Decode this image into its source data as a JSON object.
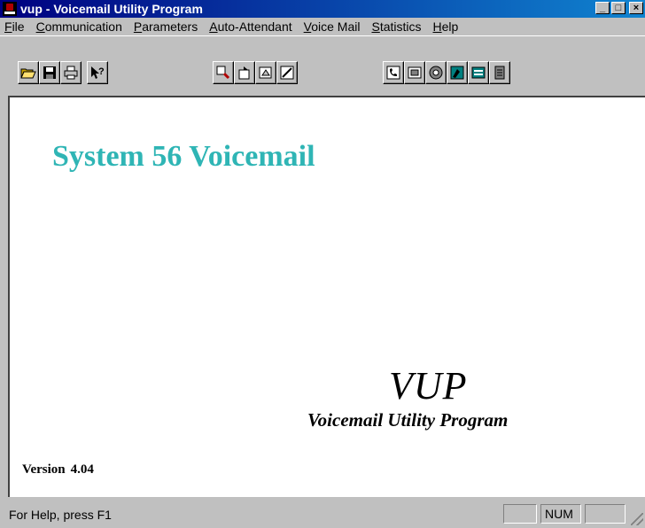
{
  "window": {
    "title": "vup - Voicemail Utility Program",
    "minimize": "_",
    "maximize": "□",
    "close": "×"
  },
  "menu": {
    "items": [
      {
        "accel": "F",
        "rest": "ile"
      },
      {
        "accel": "C",
        "rest": "ommunication"
      },
      {
        "accel": "P",
        "rest": "arameters"
      },
      {
        "accel": "A",
        "rest": "uto-Attendant"
      },
      {
        "accel": "V",
        "rest": "oice Mail"
      },
      {
        "accel": "S",
        "rest": "tatistics"
      },
      {
        "accel": "H",
        "rest": "elp"
      }
    ]
  },
  "toolbar": {
    "groups": [
      [
        "open-folder-icon",
        "save-disk-icon",
        "print-icon",
        "context-help-icon"
      ],
      [
        "zoom-icon",
        "export-icon",
        "erase-icon",
        "edit-pencil-icon"
      ],
      [
        "phone-icon",
        "terminal-icon",
        "dial-icon",
        "voice-icon",
        "list-icon",
        "cabinet-icon"
      ]
    ]
  },
  "content": {
    "headline": "System 56 Voicemail",
    "logo_title": "VUP",
    "logo_subtitle": "Voicemail Utility Program",
    "version_label": "Version",
    "version_number": "4.04",
    "headline_color": "#2fb5b5"
  },
  "status": {
    "help_text": "For Help, press F1",
    "num_indicator": "NUM"
  }
}
